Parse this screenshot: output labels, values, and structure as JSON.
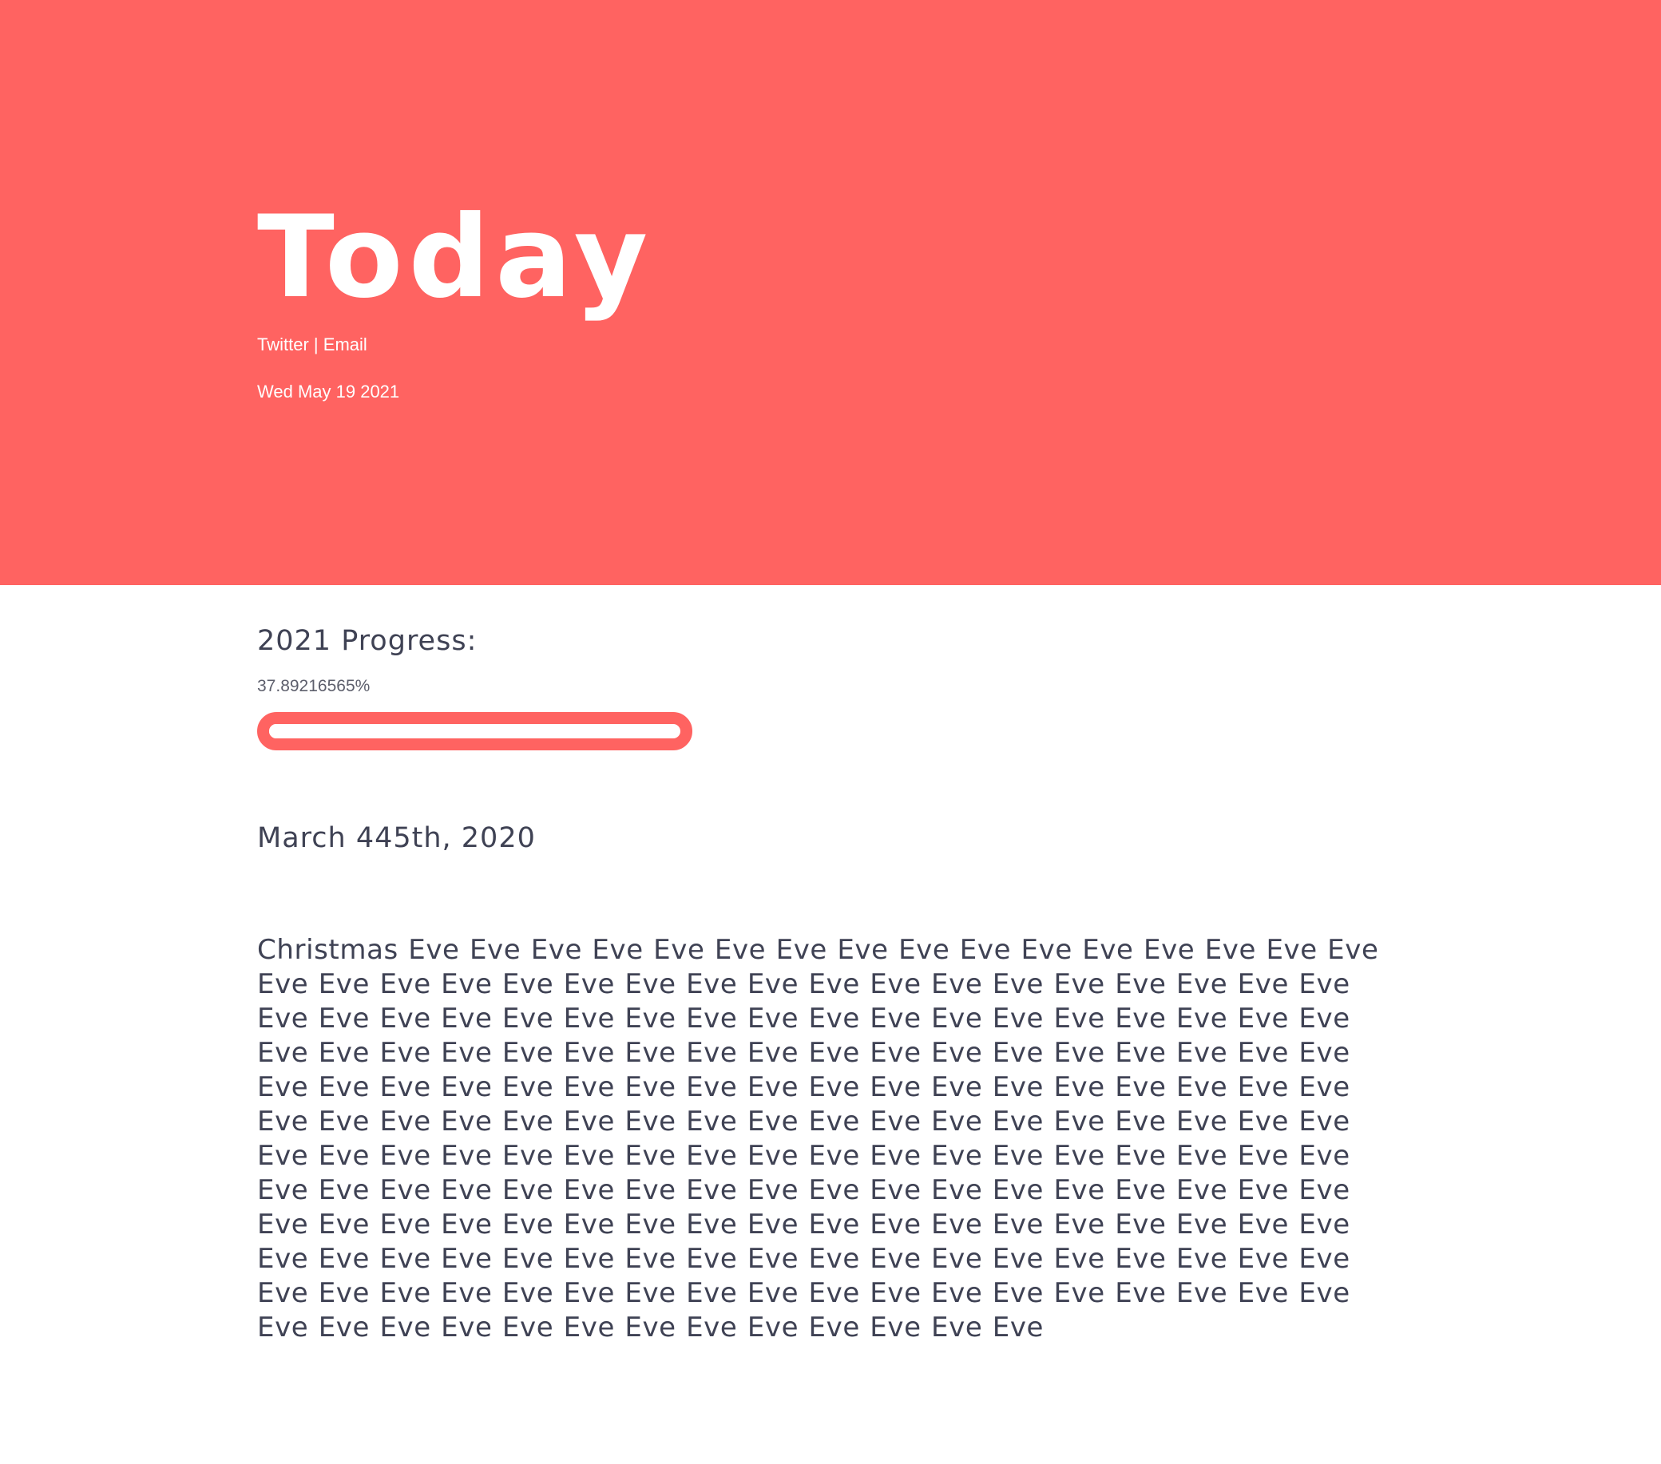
{
  "header": {
    "title": "Today",
    "links": [
      {
        "label": "Twitter"
      },
      {
        "label": "Email"
      }
    ],
    "separator": "|",
    "date": "Wed May 19 2021"
  },
  "progress": {
    "heading": "2021 Progress:",
    "value_text": "37.89216565%",
    "value": 0.3789216565
  },
  "entry": {
    "date": "March 445th, 2020",
    "body": "Christmas Eve Eve Eve Eve Eve Eve Eve Eve Eve Eve Eve Eve Eve Eve Eve Eve Eve Eve Eve Eve Eve Eve Eve Eve Eve Eve Eve Eve Eve Eve Eve Eve Eve Eve Eve Eve Eve Eve Eve Eve Eve Eve Eve Eve Eve Eve Eve Eve Eve Eve Eve Eve Eve Eve Eve Eve Eve Eve Eve Eve Eve Eve Eve Eve Eve Eve Eve Eve Eve Eve Eve Eve Eve Eve Eve Eve Eve Eve Eve Eve Eve Eve Eve Eve Eve Eve Eve Eve Eve Eve Eve Eve Eve Eve Eve Eve Eve Eve Eve Eve Eve Eve Eve Eve Eve Eve Eve Eve Eve Eve Eve Eve Eve Eve Eve Eve Eve Eve Eve Eve Eve Eve Eve Eve Eve Eve Eve Eve Eve Eve Eve Eve Eve Eve Eve Eve Eve Eve Eve Eve Eve Eve Eve Eve Eve Eve Eve Eve Eve Eve Eve Eve Eve Eve Eve Eve Eve Eve Eve Eve Eve Eve Eve Eve Eve Eve Eve Eve Eve Eve Eve Eve Eve Eve Eve Eve Eve Eve Eve Eve Eve Eve Eve Eve Eve Eve Eve Eve Eve Eve Eve Eve Eve Eve Eve Eve Eve Eve Eve Eve Eve Eve Eve Eve Eve Eve Eve Eve Eve"
  },
  "colors": {
    "accent": "#ff6361",
    "text": "#3f4254",
    "background": "#ffffff"
  }
}
